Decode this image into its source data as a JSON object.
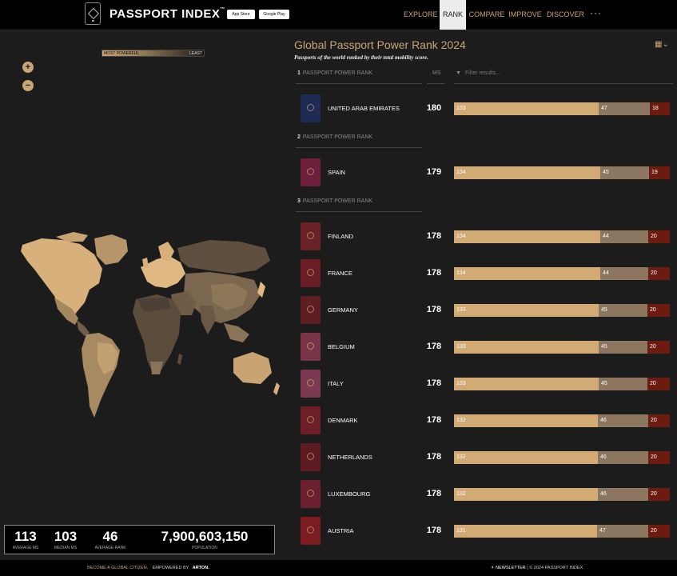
{
  "header": {
    "brand": "PASSPORT INDEX",
    "trademark": "™",
    "app_store_label": "App Store",
    "google_play_label": "Google Play",
    "nav": [
      {
        "label": "EXPLORE",
        "active": false
      },
      {
        "label": "RANK",
        "active": true
      },
      {
        "label": "COMPARE",
        "active": false
      },
      {
        "label": "IMPROVE",
        "active": false
      },
      {
        "label": "DISCOVER",
        "active": false
      }
    ],
    "more_label": "···"
  },
  "map": {
    "legend_left": "MOST POWERFUL",
    "legend_right": "LEAST",
    "zoom_in": "+",
    "zoom_out": "−"
  },
  "stats": [
    {
      "value": "113",
      "label": "AVERAGE MS"
    },
    {
      "value": "103",
      "label": "MEDIAN MS"
    },
    {
      "value": "46",
      "label": "AVERAGE RANK"
    },
    {
      "value": "7,900,603,150",
      "label": "POPULATION"
    }
  ],
  "panel": {
    "title": "Global Passport Power Rank 2024",
    "subtitle": "Passports of the world ranked by their total mobility score.",
    "ms_header": "MS",
    "filter_placeholder": "Filter results...",
    "rank_label": "PASSPORT POWER RANK"
  },
  "colors": {
    "accent": "#c9a675",
    "visa_free": "#d1aa74",
    "visa_on_arrival": "#8c7660",
    "visa_required": "#6c1b10"
  },
  "ranks": [
    {
      "rank": "1",
      "countries": [
        {
          "name": "UNITED ARAB EMIRATES",
          "ms": "180",
          "segments": [
            133,
            47,
            18
          ],
          "passport_color": "#1f2a55"
        }
      ]
    },
    {
      "rank": "2",
      "countries": [
        {
          "name": "SPAIN",
          "ms": "179",
          "segments": [
            134,
            45,
            19
          ],
          "passport_color": "#6e1f3c"
        }
      ]
    },
    {
      "rank": "3",
      "countries": [
        {
          "name": "FINLAND",
          "ms": "178",
          "segments": [
            134,
            44,
            20
          ],
          "passport_color": "#6b2128"
        },
        {
          "name": "FRANCE",
          "ms": "178",
          "segments": [
            134,
            44,
            20
          ],
          "passport_color": "#6a1d24"
        },
        {
          "name": "GERMANY",
          "ms": "178",
          "segments": [
            133,
            45,
            20
          ],
          "passport_color": "#5e1f22"
        },
        {
          "name": "BELGIUM",
          "ms": "178",
          "segments": [
            133,
            45,
            20
          ],
          "passport_color": "#7a3448"
        },
        {
          "name": "ITALY",
          "ms": "178",
          "segments": [
            133,
            45,
            20
          ],
          "passport_color": "#7b3a52"
        },
        {
          "name": "DENMARK",
          "ms": "178",
          "segments": [
            132,
            46,
            20
          ],
          "passport_color": "#6e1e26"
        },
        {
          "name": "NETHERLANDS",
          "ms": "178",
          "segments": [
            132,
            46,
            20
          ],
          "passport_color": "#5f1b22"
        },
        {
          "name": "LUXEMBOURG",
          "ms": "178",
          "segments": [
            132,
            46,
            20
          ],
          "passport_color": "#6c1f2e"
        },
        {
          "name": "AUSTRIA",
          "ms": "178",
          "segments": [
            131,
            47,
            20
          ],
          "passport_color": "#7a1c20"
        }
      ]
    }
  ],
  "footer": {
    "become": "BECOME A GLOBAL CITIZEN.",
    "empowered": "EMPOWERED BY",
    "arton": "ARTON.",
    "newsletter": "NEWSLETTER",
    "copyright": "| © 2024 PASSPORT INDEX"
  }
}
